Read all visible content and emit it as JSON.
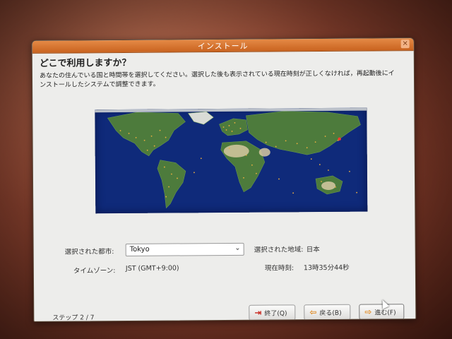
{
  "window": {
    "title": "インストール",
    "close_icon": "close-icon"
  },
  "page": {
    "heading": "どこで利用しますか？",
    "description": "あなたの住んでいる国と時間帯を選択してください。選択した後も表示されている現在時刻が正しくなければ，再起動後にインストールしたシステムで調整できます。"
  },
  "selection": {
    "city_label": "選択された都市:",
    "city_value": "Tokyo",
    "region_label": "選択された地域:",
    "region_value": "日本",
    "timezone_label": "タイムゾーン:",
    "timezone_value": "JST (GMT+9:00)",
    "time_label": "現在時刻:",
    "time_value": "13時35分44秒"
  },
  "footer": {
    "step_text": "ステップ 2 / 7",
    "quit_label": "終了(Q)",
    "back_label": "戻る(B)",
    "forward_label": "進む(F)"
  },
  "colors": {
    "titlebar": "#d7722f",
    "ocean": "#0f2a7a",
    "land": "#4a7a3a",
    "city_dot": "#f0b040"
  }
}
